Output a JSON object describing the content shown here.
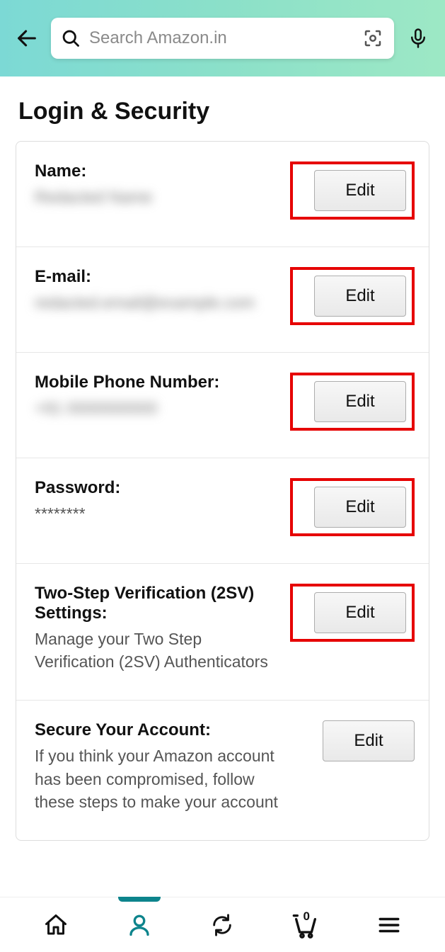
{
  "header": {
    "search_placeholder": "Search Amazon.in"
  },
  "page": {
    "title": "Login & Security"
  },
  "settings": {
    "name": {
      "label": "Name:",
      "value": "Redacted Name",
      "edit": "Edit",
      "highlighted": true
    },
    "email": {
      "label": "E-mail:",
      "value": "redacted.email@example.com",
      "edit": "Edit",
      "highlighted": true
    },
    "mobile": {
      "label": "Mobile Phone Number:",
      "value": "+91 0000000000",
      "edit": "Edit",
      "highlighted": true
    },
    "password": {
      "label": "Password:",
      "value": "********",
      "edit": "Edit",
      "highlighted": true
    },
    "twostep": {
      "label": "Two-Step Verification (2SV) Settings:",
      "value": "Manage your Two Step Verification (2SV) Authenticators",
      "edit": "Edit",
      "highlighted": true
    },
    "secure": {
      "label": "Secure Your Account:",
      "value": "If you think your Amazon account has been compromised, follow these steps to make your account",
      "edit": "Edit",
      "highlighted": false
    }
  },
  "nav": {
    "cart_count": "0"
  }
}
